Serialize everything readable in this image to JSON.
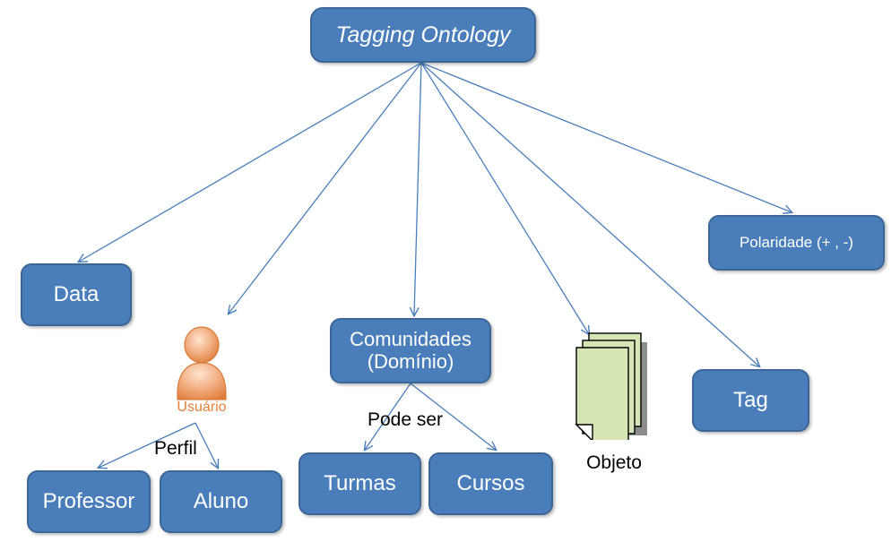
{
  "diagram": {
    "title": "Tagging Ontology",
    "background": "#ffffff",
    "node_fill": "#4a7ebb",
    "node_border": "#3c6697",
    "node_text": "#ffffff",
    "edge_color": "#4a7ebb",
    "label_text": "#000000",
    "usuario_color": "#e8803a",
    "objeto_fill": "#d6e5b4"
  },
  "nodes": {
    "root": {
      "label": "Tagging Ontology"
    },
    "data": {
      "label": "Data"
    },
    "usuario": {
      "label": "Usuário"
    },
    "comunidades": {
      "label": "Comunidades\n(Domínio)",
      "line1": "Comunidades",
      "line2": "(Domínio)"
    },
    "objeto": {
      "label": "Objeto"
    },
    "polaridade": {
      "label": "Polaridade (+ , -)"
    },
    "tag": {
      "label": "Tag"
    },
    "professor": {
      "label": "Professor"
    },
    "aluno": {
      "label": "Aluno"
    },
    "turmas": {
      "label": "Turmas"
    },
    "cursos": {
      "label": "Cursos"
    }
  },
  "edge_labels": {
    "perfil": "Perfil",
    "pode_ser": "Pode ser"
  },
  "edges": [
    {
      "from": "root",
      "to": "data"
    },
    {
      "from": "root",
      "to": "usuario"
    },
    {
      "from": "root",
      "to": "comunidades"
    },
    {
      "from": "root",
      "to": "objeto"
    },
    {
      "from": "root",
      "to": "polaridade"
    },
    {
      "from": "root",
      "to": "tag"
    },
    {
      "from": "usuario",
      "to": "professor",
      "label": "Perfil"
    },
    {
      "from": "usuario",
      "to": "aluno",
      "label": "Perfil"
    },
    {
      "from": "comunidades",
      "to": "turmas",
      "label": "Pode ser"
    },
    {
      "from": "comunidades",
      "to": "cursos",
      "label": "Pode ser"
    }
  ]
}
